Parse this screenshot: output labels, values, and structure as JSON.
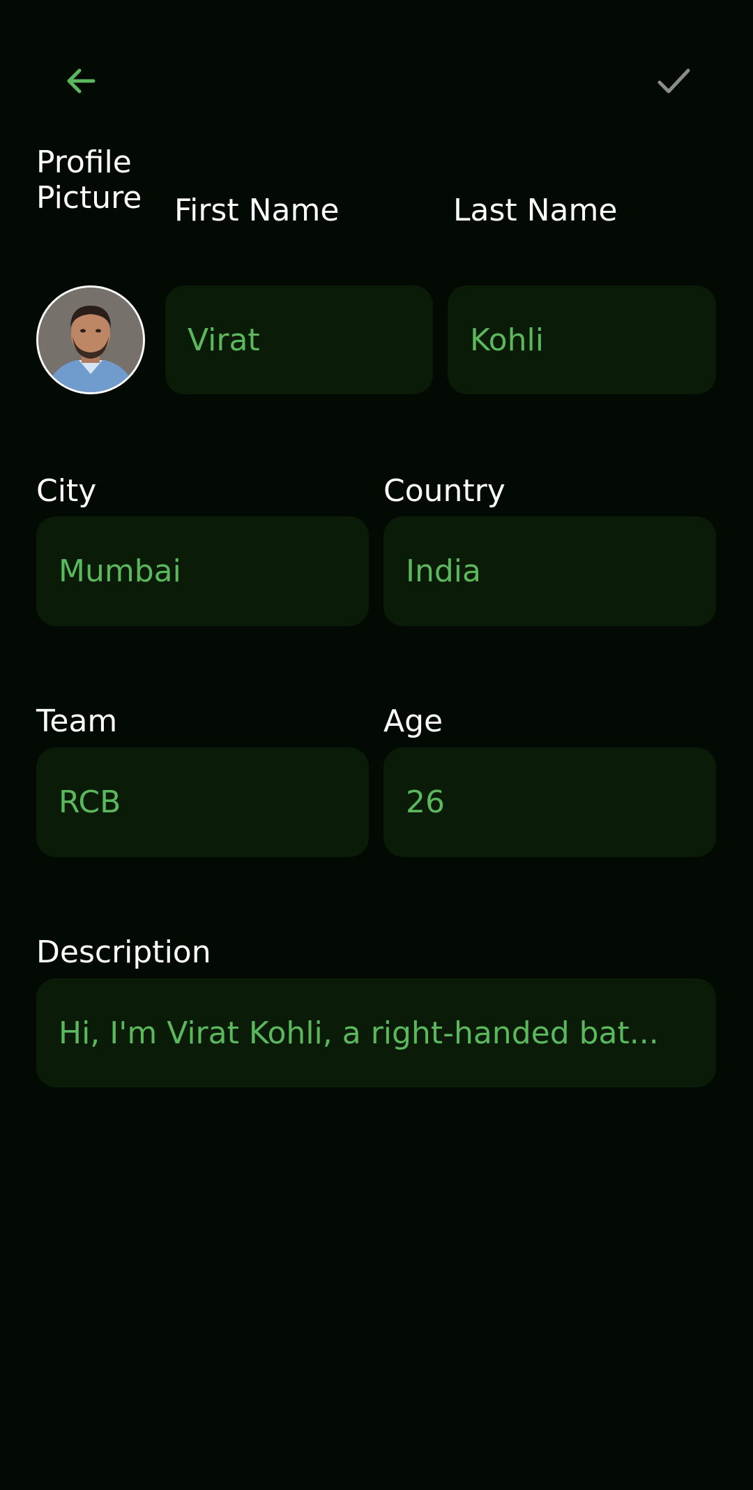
{
  "toolbar": {
    "back_icon": "arrow-left-icon",
    "save_icon": "check-icon"
  },
  "colors": {
    "background": "#030a03",
    "field_background": "#0a1b08",
    "accent": "#5cb85c",
    "label": "#ffffff",
    "check_icon": "#8c8c8c"
  },
  "labels": {
    "profile_picture": "Profile\nPicture",
    "first_name": "First Name",
    "last_name": "Last Name",
    "city": "City",
    "country": "Country",
    "team": "Team",
    "age": "Age",
    "description": "Description"
  },
  "fields": {
    "first_name": "Virat",
    "last_name": "Kohli",
    "city": "Mumbai",
    "country": "India",
    "team": "RCB",
    "age": "26",
    "description": "Hi, I'm Virat Kohli, a right-handed bat..."
  },
  "avatar": {
    "icon": "profile-photo"
  }
}
